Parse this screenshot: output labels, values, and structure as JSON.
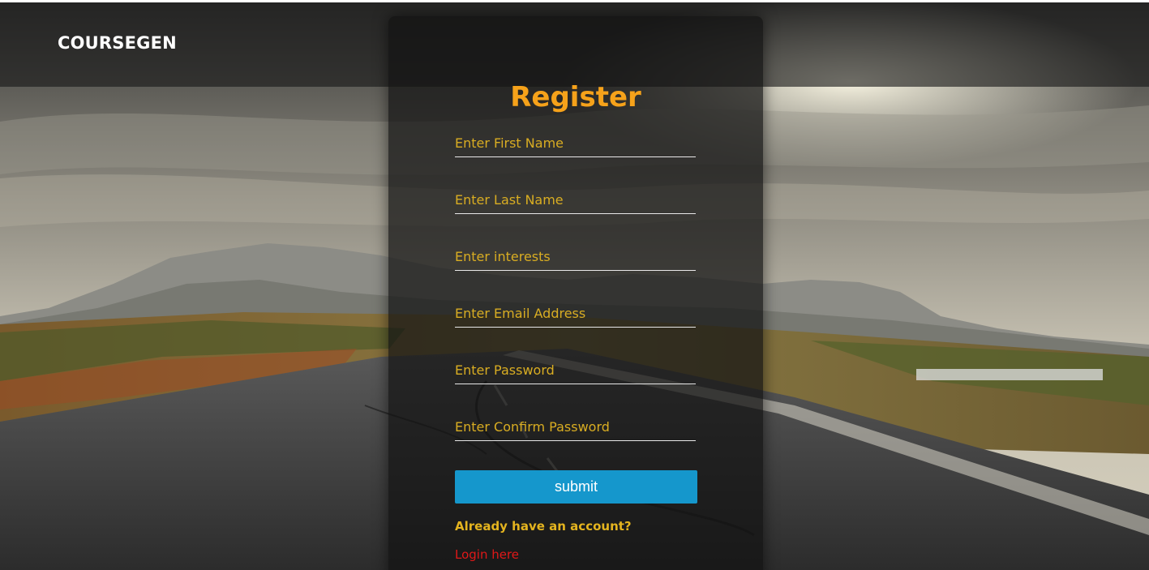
{
  "navbar": {
    "brand": "COURSEGEN"
  },
  "register": {
    "title": "Register",
    "fields": [
      {
        "name": "first_name",
        "placeholder": "Enter First Name",
        "value": ""
      },
      {
        "name": "last_name",
        "placeholder": "Enter Last Name",
        "value": ""
      },
      {
        "name": "interests",
        "placeholder": "Enter interests",
        "value": ""
      },
      {
        "name": "email",
        "placeholder": "Enter Email Address",
        "value": ""
      },
      {
        "name": "password",
        "placeholder": "Enter Password",
        "value": ""
      },
      {
        "name": "confirm_password",
        "placeholder": "Enter Confirm Password",
        "value": ""
      }
    ],
    "submit_label": "submit",
    "have_account_text": "Already have an account?",
    "login_link": "Login here"
  },
  "colors": {
    "title": "#f6a21a",
    "placeholder": "#d9ad22",
    "submit_bg": "#1597cc",
    "login_link": "#e01818"
  },
  "background": {
    "scene": "mountain-road-landscape-photo"
  }
}
